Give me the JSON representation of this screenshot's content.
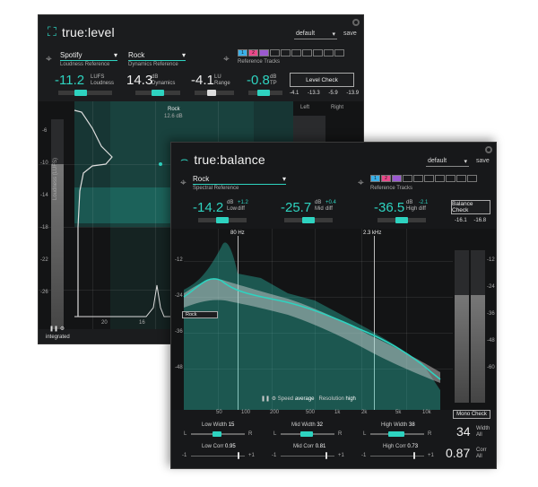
{
  "level": {
    "logo": "true:level",
    "preset": "default",
    "save": "save",
    "loudness_ref": {
      "value": "Spotify",
      "label": "Loudness Reference"
    },
    "dynamics_ref": {
      "value": "Rock",
      "label": "Dynamics Reference"
    },
    "ref_tracks_label": "Reference Tracks",
    "ref_tracks": [
      "1",
      "2",
      "",
      "",
      "",
      "",
      "",
      "",
      "",
      ""
    ],
    "lufs": {
      "value": "-11.2",
      "unit": "LUFS",
      "label": "Loudness"
    },
    "db_dyn": {
      "value": "14.3",
      "unit": "dB",
      "label": "Dynamics"
    },
    "lu": {
      "value": "-4.1",
      "unit": "LU",
      "label": "Range"
    },
    "tp": {
      "value": "-0.8",
      "unit": "dB",
      "label": "TP"
    },
    "level_check": "Level Check",
    "meter_values": [
      "-4.1",
      "-13.3",
      "-5.9",
      "-13.9"
    ],
    "channels": [
      "Left",
      "Right"
    ],
    "y_ticks": [
      "-6",
      "-10",
      "-14",
      "-18",
      "-22",
      "-26"
    ],
    "x_ticks": [
      "20",
      "16"
    ],
    "rock_label": "Rock",
    "rock_value": "12.6 dB",
    "loudness_axis": "Loudness (LUFS)",
    "integrated": "integrated"
  },
  "balance": {
    "logo": "true:balance",
    "preset": "default",
    "save": "save",
    "spectral_ref": {
      "value": "Rock",
      "label": "Spectral Reference"
    },
    "ref_tracks_label": "Reference Tracks",
    "ref_tracks": [
      "1",
      "2",
      "",
      "",
      "",
      "",
      "",
      "",
      "",
      ""
    ],
    "low": {
      "value": "-14.2",
      "unit": "dB",
      "label": "Low",
      "diff": "+1.2",
      "diff_label": "diff"
    },
    "mid": {
      "value": "-25.7",
      "unit": "dB",
      "label": "Mid",
      "diff": "+0.4",
      "diff_label": "diff"
    },
    "high": {
      "value": "-36.5",
      "unit": "dB",
      "label": "High",
      "diff": "-2.1",
      "diff_label": "diff"
    },
    "balance_check": "Balance Check",
    "meter_values": [
      "-16.1",
      "-16.8"
    ],
    "freq_markers": [
      "80 Hz",
      "2.3 kHz"
    ],
    "y_ticks_left": [
      "-12",
      "-24",
      "-36",
      "-48"
    ],
    "y_ticks_right": [
      "-12",
      "-24",
      "-36",
      "-48",
      "-60"
    ],
    "x_ticks": [
      "50",
      "100",
      "200",
      "500",
      "1k",
      "2k",
      "5k",
      "10k"
    ],
    "rock_tag": "Rock",
    "speed_label": "Speed",
    "speed_value": "average",
    "resolution_label": "Resolution",
    "resolution_value": "high",
    "mono_check": "Mono Check",
    "low_width": {
      "label": "Low Width",
      "value": "15"
    },
    "mid_width": {
      "label": "Mid Width",
      "value": "32"
    },
    "high_width": {
      "label": "High Width",
      "value": "38"
    },
    "low_corr": {
      "label": "Low Corr",
      "value": "0.95"
    },
    "mid_corr": {
      "label": "Mid Corr",
      "value": "0.81"
    },
    "high_corr": {
      "label": "High Corr",
      "value": "0.73"
    },
    "width_all": {
      "value": "34",
      "label": "Width",
      "sub": "All"
    },
    "corr_all": {
      "value": "0.87",
      "label": "Corr",
      "sub": "All"
    },
    "lr": [
      "L",
      "R"
    ],
    "corr_range": [
      "-1",
      "+1"
    ]
  },
  "colors": {
    "accent": "#2ed3c0",
    "bg": "#1b1c1e",
    "ref1": "#3ab0e8",
    "ref2": "#e84a8a",
    "ref3": "#9b59d0"
  }
}
